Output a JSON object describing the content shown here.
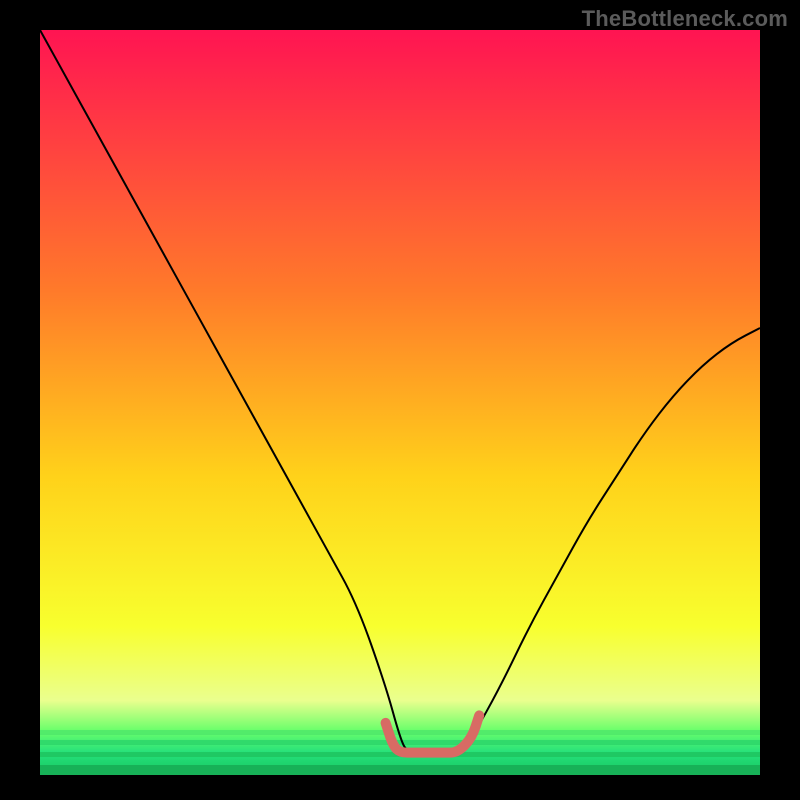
{
  "watermark": "TheBottleneck.com",
  "colors": {
    "background": "#000000",
    "grad_top": "#ff1452",
    "grad_mid1": "#ff7a2a",
    "grad_mid2": "#ffd21a",
    "grad_mid3": "#f8ff2e",
    "grad_low": "#eaff8e",
    "grad_green1": "#6bff6b",
    "grad_green2": "#25e07a",
    "grad_green3": "#18c862",
    "curve": "#000000",
    "highlight": "#d86b64"
  },
  "chart_data": {
    "type": "line",
    "title": "",
    "xlabel": "",
    "ylabel": "",
    "xlim": [
      0,
      100
    ],
    "ylim": [
      0,
      100
    ],
    "series": [
      {
        "name": "bottleneck-curve",
        "x": [
          0,
          4,
          8,
          12,
          16,
          20,
          24,
          28,
          32,
          36,
          40,
          44,
          48,
          50,
          51,
          54,
          58,
          60,
          64,
          68,
          72,
          76,
          80,
          84,
          88,
          92,
          96,
          100
        ],
        "y": [
          100,
          93,
          86,
          79,
          72,
          65,
          58,
          51,
          44,
          37,
          30,
          23,
          12,
          5,
          3,
          3,
          3,
          5,
          12,
          20,
          27,
          34,
          40,
          46,
          51,
          55,
          58,
          60
        ]
      },
      {
        "name": "optimal-range",
        "x": [
          48,
          49,
          50,
          52,
          54,
          56,
          58,
          60,
          61
        ],
        "y": [
          7,
          4,
          3,
          3,
          3,
          3,
          3,
          5,
          8
        ]
      }
    ],
    "annotations": []
  }
}
